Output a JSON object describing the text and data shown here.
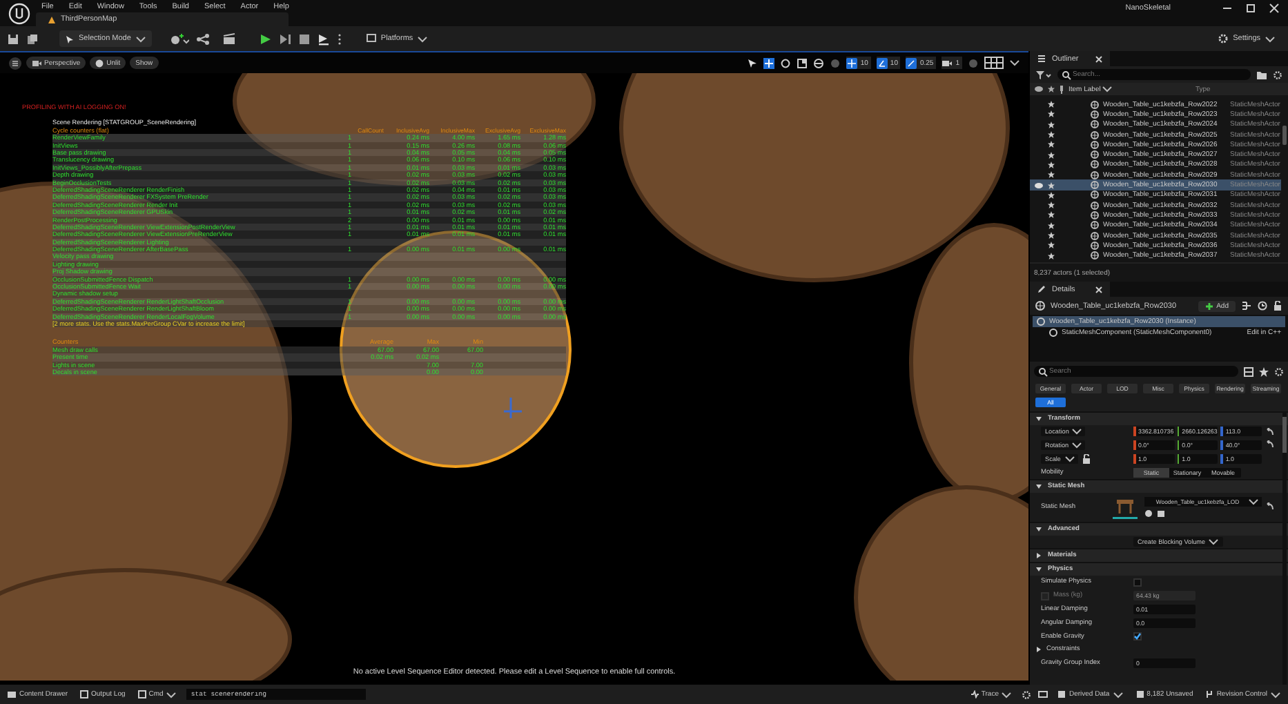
{
  "title_bar": {
    "menu": [
      "File",
      "Edit",
      "Window",
      "Tools",
      "Build",
      "Select",
      "Actor",
      "Help"
    ],
    "map_tab": "ThirdPersonMap",
    "project": "NanoSkeletal"
  },
  "toolbar": {
    "mode": "Selection Mode",
    "platforms": "Platforms",
    "settings": "Settings"
  },
  "viewport": {
    "toolbar": {
      "view": "Perspective",
      "mode": "Unlit",
      "show": "Show",
      "grid_snap": "10",
      "rotate_snap": "10",
      "scale_snap": "0.25",
      "camera_speed": "1"
    },
    "stats": {
      "warning": "PROFILING WITH AI LOGGING ON!",
      "group": "Scene Rendering [STATGROUP_SceneRendering]",
      "section": "Cycle counters (flat)",
      "columns": [
        "CallCount",
        "InclusiveAvg",
        "InclusiveMax",
        "ExclusiveAvg",
        "ExclusiveMax"
      ],
      "rows": [
        {
          "name": "RenderViewFamily",
          "values": [
            "1",
            "0.24 ms",
            "4.00 ms",
            "1.65 ms",
            "1.28 ms"
          ]
        },
        {
          "name": "InitViews",
          "values": [
            "1",
            "0.15 ms",
            "0.26 ms",
            "0.08 ms",
            "0.06 ms"
          ]
        },
        {
          "name": "Base pass drawing",
          "values": [
            "1",
            "0.04 ms",
            "0.05 ms",
            "0.04 ms",
            "0.05 ms"
          ]
        },
        {
          "name": "Translucency drawing",
          "values": [
            "1",
            "0.06 ms",
            "0.10 ms",
            "0.06 ms",
            "0.10 ms"
          ]
        },
        {
          "name": "InitViews_PossiblyAfterPrepass",
          "values": [
            "1",
            "0.01 ms",
            "0.03 ms",
            "0.01 ms",
            "0.03 ms"
          ]
        },
        {
          "name": "Depth drawing",
          "values": [
            "1",
            "0.02 ms",
            "0.03 ms",
            "0.02 ms",
            "0.03 ms"
          ]
        },
        {
          "name": "BeginOcclusionTests",
          "values": [
            "1",
            "0.02 ms",
            "0.03 ms",
            "0.02 ms",
            "0.03 ms"
          ]
        },
        {
          "name": "DeferredShadingSceneRenderer RenderFinish",
          "values": [
            "1",
            "0.02 ms",
            "0.04 ms",
            "0.01 ms",
            "0.03 ms"
          ]
        },
        {
          "name": "DeferredShadingSceneRenderer FXSystem PreRender",
          "values": [
            "1",
            "0.02 ms",
            "0.03 ms",
            "0.02 ms",
            "0.03 ms"
          ]
        },
        {
          "name": "DeferredShadingSceneRenderer Render Init",
          "values": [
            "1",
            "0.02 ms",
            "0.03 ms",
            "0.02 ms",
            "0.03 ms"
          ]
        },
        {
          "name": "DeferredShadingSceneRenderer GPUSkin",
          "values": [
            "1",
            "0.01 ms",
            "0.02 ms",
            "0.01 ms",
            "0.02 ms"
          ]
        },
        {
          "name": "RenderPostProcessing",
          "values": [
            "2",
            "0.00 ms",
            "0.01 ms",
            "0.00 ms",
            "0.01 ms"
          ]
        },
        {
          "name": "DeferredShadingSceneRenderer ViewExtensionPostRenderView",
          "values": [
            "1",
            "0.01 ms",
            "0.01 ms",
            "0.01 ms",
            "0.01 ms"
          ]
        },
        {
          "name": "DeferredShadingSceneRenderer ViewExtensionPreRenderView",
          "values": [
            "1",
            "0.01 ms",
            "0.01 ms",
            "0.01 ms",
            "0.01 ms"
          ]
        },
        {
          "name": "DeferredShadingSceneRenderer Lighting",
          "values": []
        },
        {
          "name": "DeferredShadingSceneRenderer AfterBasePass",
          "values": [
            "1",
            "0.00 ms",
            "0.01 ms",
            "0.00 ms",
            "0.01 ms"
          ]
        },
        {
          "name": "Velocity pass drawing",
          "values": []
        },
        {
          "name": "Lighting drawing",
          "values": []
        },
        {
          "name": "Proj Shadow drawing",
          "values": []
        },
        {
          "name": "OcclusionSubmittedFence Dispatch",
          "values": [
            "1",
            "0.00 ms",
            "0.00 ms",
            "0.00 ms",
            "0.00 ms"
          ]
        },
        {
          "name": "OcclusionSubmittedFence Wait",
          "values": [
            "1",
            "0.00 ms",
            "0.00 ms",
            "0.00 ms",
            "0.00 ms"
          ]
        },
        {
          "name": "Dynamic shadow setup",
          "values": []
        },
        {
          "name": "DeferredShadingSceneRenderer RenderLightShaftOcclusion",
          "values": [
            "1",
            "0.00 ms",
            "0.00 ms",
            "0.00 ms",
            "0.00 ms"
          ]
        },
        {
          "name": "DeferredShadingSceneRenderer RenderLightShaftBloom",
          "values": [
            "1",
            "0.00 ms",
            "0.00 ms",
            "0.00 ms",
            "0.00 ms"
          ]
        },
        {
          "name": "DeferredShadingSceneRenderer RenderLocalFogVolume",
          "values": [
            "1",
            "0.00 ms",
            "0.00 ms",
            "0.00 ms",
            "0.00 ms"
          ]
        }
      ],
      "note": "[2 more stats. Use the stats.MaxPerGroup CVar to increase the limit]",
      "counters": {
        "columns": [
          "Counters",
          "Average",
          "Max",
          "Min"
        ],
        "rows": [
          {
            "name": "Mesh draw calls",
            "average": "67.00",
            "max": "67.00",
            "min": "67.00"
          },
          {
            "name": "Present time",
            "average": "0.02 ms",
            "max": "0.02 ms"
          },
          {
            "name": "Lights in scene",
            "max": "7.00",
            "min": "7.00"
          },
          {
            "name": "Decals in scene",
            "max": "0.00",
            "min": "0.00"
          }
        ]
      }
    },
    "message": "No active Level Sequence Editor detected. Please edit a Level Sequence to enable full controls."
  },
  "outliner": {
    "title": "Outliner",
    "search": {
      "placeholder": "Search..."
    },
    "columns": [
      "Item Label",
      "Type"
    ],
    "rows": [
      {
        "label": "Wooden_Table_uc1kebzfa_Row2022",
        "type": "StaticMeshActor",
        "selected": false
      },
      {
        "label": "Wooden_Table_uc1kebzfa_Row2023",
        "type": "StaticMeshActor",
        "selected": false
      },
      {
        "label": "Wooden_Table_uc1kebzfa_Row2024",
        "type": "StaticMeshActor",
        "selected": false
      },
      {
        "label": "Wooden_Table_uc1kebzfa_Row2025",
        "type": "StaticMeshActor",
        "selected": false
      },
      {
        "label": "Wooden_Table_uc1kebzfa_Row2026",
        "type": "StaticMeshActor",
        "selected": false
      },
      {
        "label": "Wooden_Table_uc1kebzfa_Row2027",
        "type": "StaticMeshActor",
        "selected": false
      },
      {
        "label": "Wooden_Table_uc1kebzfa_Row2028",
        "type": "StaticMeshActor",
        "selected": false
      },
      {
        "label": "Wooden_Table_uc1kebzfa_Row2029",
        "type": "StaticMeshActor",
        "selected": false
      },
      {
        "label": "Wooden_Table_uc1kebzfa_Row2030",
        "type": "StaticMeshActor",
        "selected": true
      },
      {
        "label": "Wooden_Table_uc1kebzfa_Row2031",
        "type": "StaticMeshActor",
        "selected": false
      },
      {
        "label": "Wooden_Table_uc1kebzfa_Row2032",
        "type": "StaticMeshActor",
        "selected": false
      },
      {
        "label": "Wooden_Table_uc1kebzfa_Row2033",
        "type": "StaticMeshActor",
        "selected": false
      },
      {
        "label": "Wooden_Table_uc1kebzfa_Row2034",
        "type": "StaticMeshActor",
        "selected": false
      },
      {
        "label": "Wooden_Table_uc1kebzfa_Row2035",
        "type": "StaticMeshActor",
        "selected": false
      },
      {
        "label": "Wooden_Table_uc1kebzfa_Row2036",
        "type": "StaticMeshActor",
        "selected": false
      },
      {
        "label": "Wooden_Table_uc1kebzfa_Row2037",
        "type": "StaticMeshActor",
        "selected": false
      }
    ],
    "footer": "8,237 actors (1 selected)"
  },
  "details": {
    "title": "Details",
    "actor": "Wooden_Table_uc1kebzfa_Row2030",
    "add": "Add",
    "components": [
      {
        "label": "Wooden_Table_uc1kebzfa_Row2030 (Instance)",
        "selected": true
      },
      {
        "label": "StaticMeshComponent (StaticMeshComponent0)",
        "selected": false,
        "action": "Edit in C++"
      }
    ],
    "search": {
      "placeholder": "Search"
    },
    "filters": [
      {
        "label": "General",
        "selected": false
      },
      {
        "label": "Actor",
        "selected": false
      },
      {
        "label": "LOD",
        "selected": false
      },
      {
        "label": "Misc",
        "selected": false
      },
      {
        "label": "Physics",
        "selected": false
      },
      {
        "label": "Rendering",
        "selected": false
      },
      {
        "label": "Streaming",
        "selected": false
      },
      {
        "label": "All",
        "selected": true
      }
    ],
    "sections": [
      {
        "title": "Transform",
        "expanded": true,
        "rows": [
          {
            "kind": "vector",
            "label": "Location",
            "values": [
              "3362.810736",
              "2660.126263",
              "113.0"
            ]
          },
          {
            "kind": "vector",
            "label": "Rotation",
            "values": [
              "0.0°",
              "0.0°",
              "40.0°"
            ]
          },
          {
            "kind": "vector",
            "label": "Scale",
            "values": [
              "1.0",
              "1.0",
              "1.0"
            ]
          },
          {
            "kind": "segmented",
            "label": "Mobility",
            "options": [
              {
                "label": "Static",
                "selected": true
              },
              {
                "label": "Stationary",
                "selected": false
              },
              {
                "label": "Movable",
                "selected": false
              }
            ]
          }
        ]
      },
      {
        "title": "Static Mesh",
        "expanded": true,
        "rows": [
          {
            "kind": "asset",
            "label": "Static Mesh",
            "value": "Wooden_Table_uc1kebzfa_LOD"
          }
        ]
      },
      {
        "title": "Advanced",
        "expanded": true,
        "rows": [
          {
            "kind": "dropdown",
            "value": "Create Blocking Volume"
          }
        ]
      },
      {
        "title": "Materials",
        "expanded": false
      },
      {
        "title": "Physics",
        "expanded": true,
        "rows": [
          {
            "kind": "checkbox",
            "label": "Simulate Physics",
            "checked": false
          },
          {
            "kind": "checked-number",
            "label": "Mass (kg)",
            "checked": false,
            "disabled": true,
            "value": "64.43 kg"
          },
          {
            "kind": "number",
            "label": "Linear Damping",
            "value": "0.01"
          },
          {
            "kind": "number",
            "label": "Angular Damping",
            "value": "0.0"
          },
          {
            "kind": "checkbox",
            "label": "Enable Gravity",
            "checked": true
          },
          {
            "kind": "group",
            "label": "Constraints",
            "expanded": false
          },
          {
            "kind": "number",
            "label": "Gravity Group Index",
            "value": "0"
          }
        ]
      }
    ]
  },
  "status_bar": {
    "content_drawer": "Content Drawer",
    "output_log": "Output Log",
    "console": "Cmd",
    "command": "stat scenerendering",
    "trace": "Trace",
    "derived_data": "Derived Data",
    "unsaved": "8,182 Unsaved",
    "revision_control": "Revision Control"
  }
}
